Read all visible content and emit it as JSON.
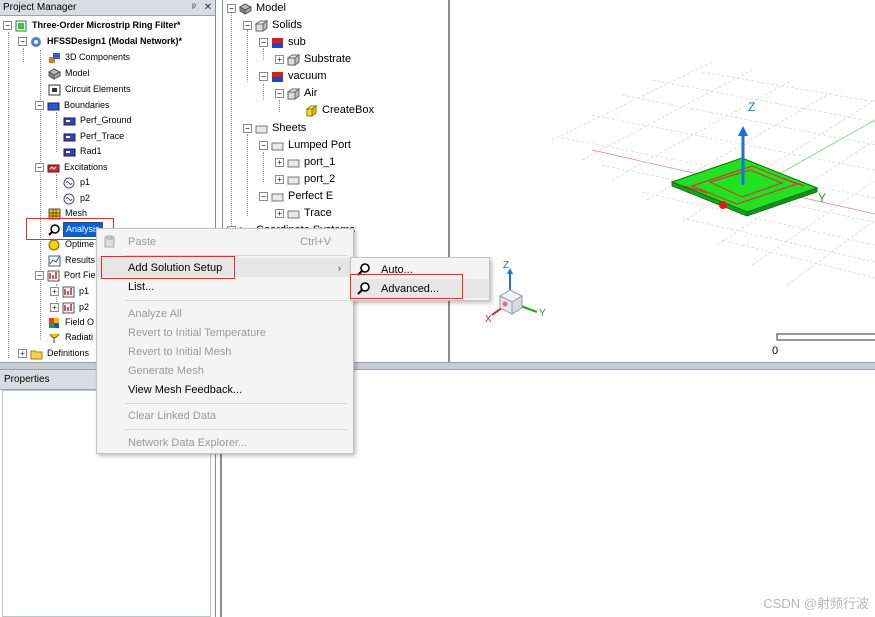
{
  "project_manager": {
    "title": "Project Manager",
    "pin": "ᵖ",
    "close": "✕",
    "project": "Three-Order Microstrip Ring Filter*",
    "design": "HFSSDesign1 (Modal Network)*",
    "items": {
      "components3d": "3D Components",
      "model": "Model",
      "circuit": "Circuit Elements",
      "boundaries": "Boundaries",
      "perf_ground": "Perf_Ground",
      "perf_trace": "Perf_Trace",
      "rad1": "Rad1",
      "excitations": "Excitations",
      "p1": "p1",
      "p2": "p2",
      "mesh": "Mesh",
      "analysis": "Analysis",
      "optimetrics": "Optime",
      "results": "Results",
      "port_field": "Port Fie",
      "port_p1": "p1",
      "port_p2": "p2",
      "field_overlays": "Field O",
      "radiation": "Radiati",
      "definitions": "Definitions"
    }
  },
  "properties": {
    "title": "Properties"
  },
  "model_tree": {
    "model": "Model",
    "solids": "Solids",
    "sub": "sub",
    "substrate": "Substrate",
    "vacuum": "vacuum",
    "air": "Air",
    "createbox": "CreateBox",
    "sheets": "Sheets",
    "lumped_port": "Lumped Port",
    "port_1": "port_1",
    "port_2": "port_2",
    "perfect_e": "Perfect E",
    "trace": "Trace",
    "coord_systems": "Coordinate Systems"
  },
  "viewport": {
    "axis_z": "Z",
    "axis_y": "Y",
    "axis_x": "X",
    "scale_zero": "0",
    "colors": {
      "substrate": "#2ecc2e",
      "trace": "#d43a2a",
      "grid": "#cfd6df",
      "axis_z": "#1f6fe0",
      "axis_x": "#e02020",
      "axis_y": "#1aa61a"
    }
  },
  "context_menu": {
    "paste": "Paste",
    "paste_shortcut": "Ctrl+V",
    "add_solution_setup": "Add Solution Setup",
    "list": "List...",
    "analyze_all": "Analyze All",
    "revert_temp": "Revert to Initial Temperature",
    "revert_mesh": "Revert to Initial Mesh",
    "generate_mesh": "Generate Mesh",
    "view_mesh_feedback": "View Mesh Feedback...",
    "clear_linked": "Clear Linked Data",
    "network_explorer": "Network Data Explorer...",
    "submenu_arrow": "›"
  },
  "submenu": {
    "auto": "Auto...",
    "advanced": "Advanced..."
  },
  "watermark": "CSDN @射频行波"
}
